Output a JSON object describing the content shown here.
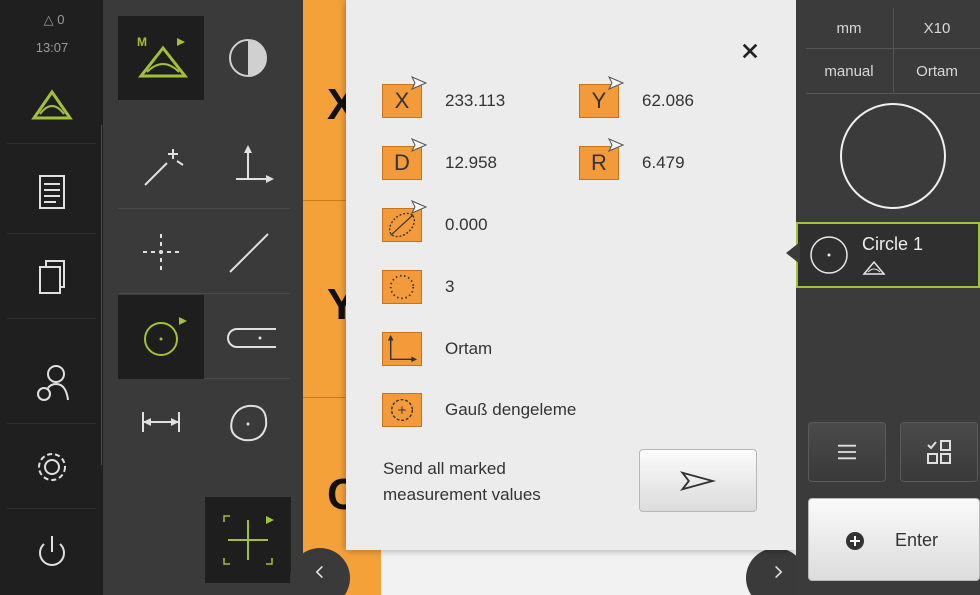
{
  "status": {
    "measure_count": "0",
    "time": "13:07"
  },
  "workspace": {
    "axis_letters": [
      "X",
      "Y",
      "C"
    ]
  },
  "dialog": {
    "rows": [
      {
        "chip": "X",
        "value": "233.113"
      },
      {
        "chip": "Y",
        "value": "62.086"
      },
      {
        "chip": "D",
        "value": "12.958"
      },
      {
        "chip": "R",
        "value": "6.479"
      },
      {
        "chip_icon": "roundness-icon",
        "value": "0.000"
      },
      {
        "chip_icon": "point-count-icon",
        "value": "3"
      },
      {
        "chip_icon": "coordinate-system-icon",
        "value": "Ortam"
      },
      {
        "chip_icon": "fitting-method-icon",
        "value": "Gauß dengeleme"
      }
    ],
    "send_text": "Send all marked measurement values"
  },
  "right_panel": {
    "unit": "mm",
    "zoom": "X10",
    "mode": "manual",
    "coord_system": "Ortam",
    "feature_name": "Circle 1",
    "enter_label": "Enter"
  },
  "colors": {
    "accent_green": "#a2c13b",
    "accent_orange": "#f39b3a"
  }
}
